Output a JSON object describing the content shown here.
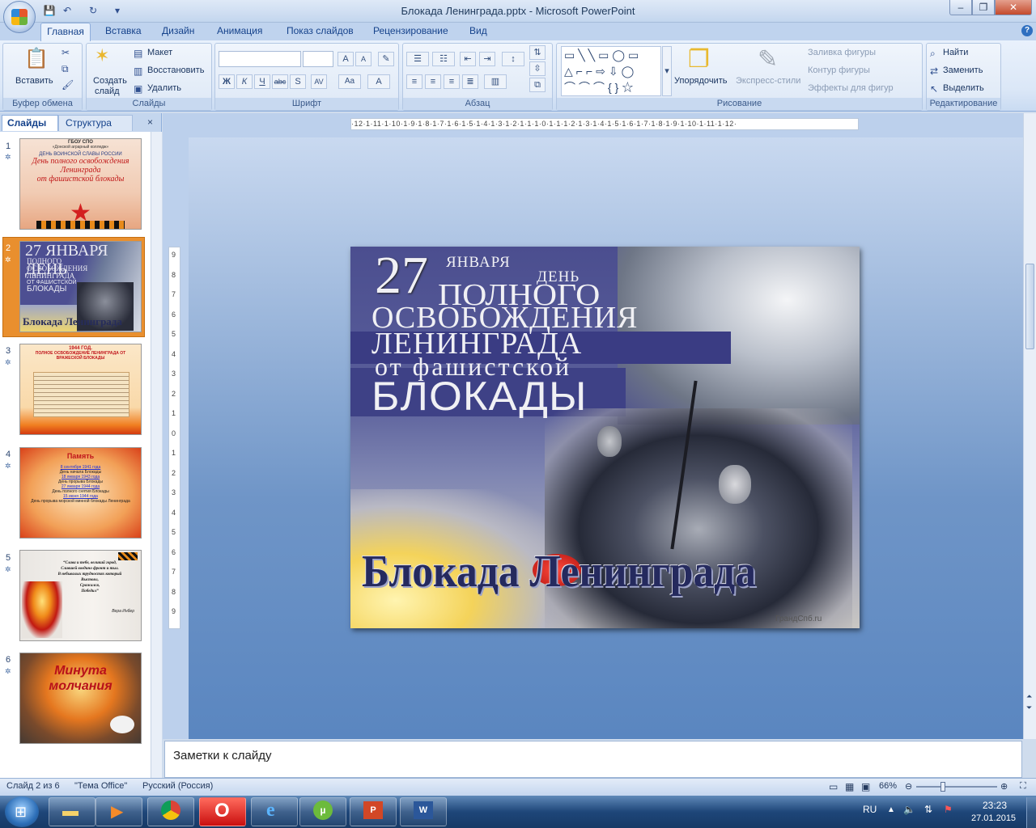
{
  "window": {
    "title": "Блокада Ленинграда.pptx - Microsoft PowerPoint",
    "min": "–",
    "max": "❐",
    "close": "✕"
  },
  "qat": [
    "💾",
    "↶",
    "↻",
    "▾"
  ],
  "tabs": [
    "Главная",
    "Вставка",
    "Дизайн",
    "Анимация",
    "Показ слайдов",
    "Рецензирование",
    "Вид"
  ],
  "help": "?",
  "ribbon": {
    "clipboard": {
      "paste": "Вставить",
      "label": "Буфер обмена"
    },
    "slides": {
      "new_slide": "Создать",
      "new_slide2": "слайд",
      "layout": "Макет",
      "reset": "Восстановить",
      "delete": "Удалить",
      "label": "Слайды"
    },
    "font": {
      "label": "Шрифт",
      "bold": "Ж",
      "italic": "К",
      "underline": "Ч",
      "strike": "abc",
      "shadow": "S",
      "spacing": "AV",
      "case": "Aa",
      "color": "A",
      "grow": "A",
      "shrink": "A"
    },
    "paragraph": {
      "label": "Абзац"
    },
    "drawing": {
      "arrange": "Упорядочить",
      "quick_styles": "Экспресс-стили",
      "fill": "Заливка фигуры",
      "outline": "Контур фигуры",
      "effects": "Эффекты для фигур",
      "label": "Рисование"
    },
    "editing": {
      "find": "Найти",
      "replace": "Заменить",
      "select": "Выделить",
      "label": "Редактирование"
    }
  },
  "panel": {
    "tab_slides": "Слайды",
    "tab_outline": "Структура",
    "close": "×"
  },
  "thumbnails": [
    {
      "num": "1",
      "lines": [
        "ГБОУ СПО",
        "«Донской аграрный колледж»",
        "ДЕНЬ ВОИНСКОЙ СЛАВЫ РОССИИ",
        "День полного освобождения",
        "Ленинграда",
        "от фашистской блокады"
      ]
    },
    {
      "num": "2",
      "lines": [
        "27 ЯНВАРЯ ДЕНЬ",
        "ПОЛНОГО",
        "ОСВОБОЖДЕНИЯ",
        "ЛЕНИНГРАДА",
        "ОТ ФАШИСТСКОЙ",
        "БЛОКАДЫ",
        "Блокада Ленинграда"
      ]
    },
    {
      "num": "3",
      "lines": [
        "1944 ГОД.",
        "ПОЛНОЕ ОСВОБОЖДЕНИЕ ЛЕНИНГРАДА ОТ",
        "ВРАЖЕСКОЙ БЛОКАДЫ"
      ]
    },
    {
      "num": "4",
      "lines": [
        "Память",
        "8 сентября 1941 года",
        "День начала Блокады",
        "18 января 1943 года",
        "День прорыва Блокады",
        "27 января 1944 года",
        "День полного снятия Блокады",
        "15 июня 1944 года",
        "День прорыва морской минной блокады Ленинграда"
      ]
    },
    {
      "num": "5",
      "lines": [
        "“Слава и тебе, великий город,",
        "Слившей воедино фронт и тыл.",
        "В небывалых трудностях который",
        "Выстоял,",
        "Сражался,",
        "Победил”",
        "Вера Инбер"
      ]
    },
    {
      "num": "6",
      "lines": [
        "Минута",
        "молчания"
      ]
    }
  ],
  "slide": {
    "line1": "27",
    "line1b": "ЯНВАРЯ",
    "line1c": "ДЕНЬ",
    "line2": "ПОЛНОГО",
    "line3": "ОСВОБОЖДЕНИЯ",
    "line4": "ЛЕНИНГРАДА",
    "line5": "от фашистской",
    "line6": "БЛОКАДЫ",
    "bottom": "Блокада Ленинграда",
    "watermark": "ГрандСпб.ru"
  },
  "ruler": {
    "h": "·12·1·11·1·10·1·9·1·8·1·7·1·6·1·5·1·4·1·3·1·2·1·1·1·0·1·1·1·2·1·3·1·4·1·5·1·6·1·7·1·8·1·9·1·10·1·11·1·12·"
  },
  "notes": {
    "placeholder": "Заметки к слайду"
  },
  "status": {
    "slide": "Слайд 2 из 6",
    "theme": "\"Тема Office\"",
    "lang": "Русский (Россия)",
    "zoom": "66%"
  },
  "tray": {
    "lang": "RU",
    "time": "23:23",
    "date": "27.01.2015"
  }
}
